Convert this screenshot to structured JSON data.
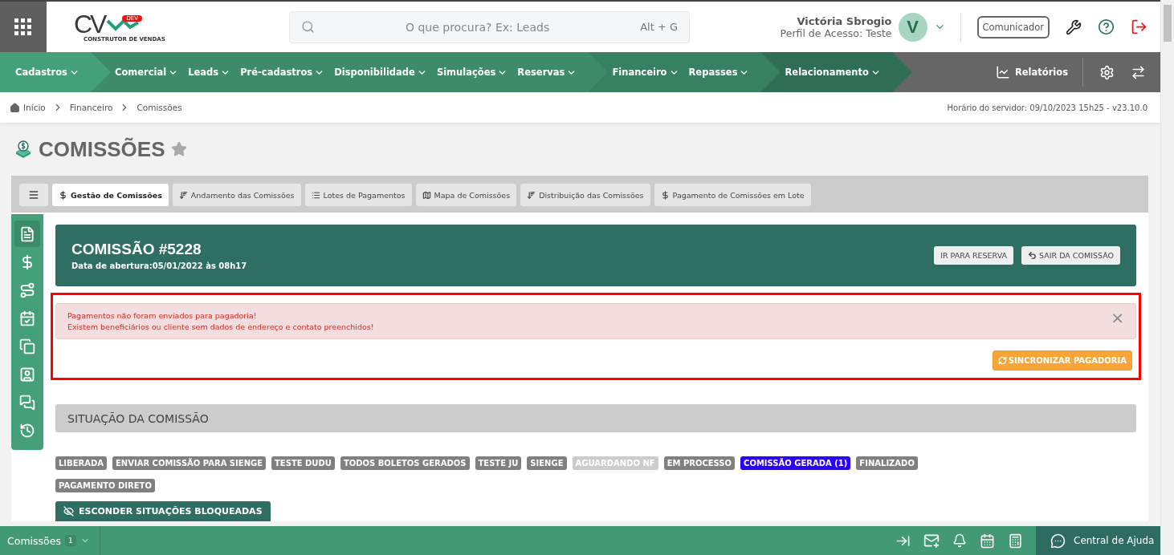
{
  "header": {
    "logo": {
      "mark": "CV",
      "badge": "DEV",
      "tagline": "CONSTRUTOR DE VENDAS"
    },
    "search": {
      "placeholder": "O que procura? Ex: Leads",
      "shortcut": "Alt + G"
    },
    "user": {
      "name": "Victória Sbrogio",
      "profile": "Perfil de Acesso: Teste",
      "initial": "V"
    },
    "communicator": "Comunicador"
  },
  "nav": {
    "segments": [
      {
        "color": "#44a079",
        "items": [
          "Cadastros"
        ]
      },
      {
        "color": "#3d8b69",
        "items": [
          "Comercial",
          "Leads",
          "Pré-cadastros",
          "Disponibilidade",
          "Simulações",
          "Reservas"
        ]
      },
      {
        "color": "#378062",
        "items": [
          "Financeiro",
          "Repasses"
        ]
      },
      {
        "color": "#2f6e55",
        "items": [
          "Relacionamento"
        ]
      }
    ],
    "reports": "Relatórios"
  },
  "breadcrumb": [
    "Início",
    "Financeiro",
    "Comissões"
  ],
  "server_time": "Horário do servidor: 09/10/2023 15h25 - v23.10.0",
  "page_title": "COMISSÕES",
  "tabs": [
    {
      "kind": "dollar",
      "label": "Gestão de Comissões",
      "selected": true
    },
    {
      "kind": "sort",
      "label": "Andamento das Comissões",
      "selected": false
    },
    {
      "kind": "list",
      "label": "Lotes de Pagamentos",
      "selected": false
    },
    {
      "kind": "map",
      "label": "Mapa de Comissões",
      "selected": false
    },
    {
      "kind": "sort",
      "label": "Distribuição das Comissões",
      "selected": false
    },
    {
      "kind": "dollar",
      "label": "Pagamento de Comissões em Lote",
      "selected": false
    }
  ],
  "sidebar": {
    "items": [
      {
        "kind": "document",
        "selected": true
      },
      {
        "kind": "dollar",
        "selected": false
      },
      {
        "kind": "route",
        "selected": false
      },
      {
        "kind": "calendar",
        "selected": false
      },
      {
        "kind": "copy",
        "selected": false
      },
      {
        "kind": "contact",
        "selected": false
      },
      {
        "kind": "chat",
        "selected": false
      },
      {
        "kind": "history",
        "selected": false
      }
    ]
  },
  "commission": {
    "title": "COMISSÃO #5228",
    "opened": "Data de abertura:05/01/2022 às 08h17",
    "buttons": [
      {
        "kind": "plain",
        "label": "IR PARA RESERVA"
      },
      {
        "kind": "back",
        "label": "SAIR DA COMISSÃO"
      }
    ]
  },
  "alert": {
    "lines": [
      "Pagamentos não foram enviados para pagadoria!",
      "Existem beneficiários ou cliente sem dados de endereço e contato preenchidos!"
    ],
    "close": "×",
    "action": "SINCRONIZAR PAGADORIA"
  },
  "situation": {
    "title": "SITUAÇÃO DA COMISSÃO",
    "tags": [
      {
        "label": "LIBERADA",
        "color": "#808080"
      },
      {
        "label": "ENVIAR COMISSÃO PARA SIENGE",
        "color": "#808080"
      },
      {
        "label": "TESTE DUDU",
        "color": "#808080"
      },
      {
        "label": "TODOS BOLETOS GERADOS",
        "color": "#808080"
      },
      {
        "label": "TESTE JU",
        "color": "#808080"
      },
      {
        "label": "SIENGE",
        "color": "#808080"
      },
      {
        "label": "AGUARDANDO NF",
        "color": "#cccccc"
      },
      {
        "label": "EM PROCESSO",
        "color": "#808080"
      },
      {
        "label": "COMISSÃO GERADA (1)",
        "color": "#2b00ff"
      },
      {
        "label": "FINALIZADO",
        "color": "#808080"
      },
      {
        "label": "PAGAMENTO DIRETO",
        "color": "#808080"
      }
    ],
    "hide_button": "ESCONDER SITUAÇÕES BLOQUEADAS"
  },
  "footer": {
    "tab": {
      "label": "Comissões",
      "count": "1"
    },
    "help": "Central de Ajuda"
  }
}
